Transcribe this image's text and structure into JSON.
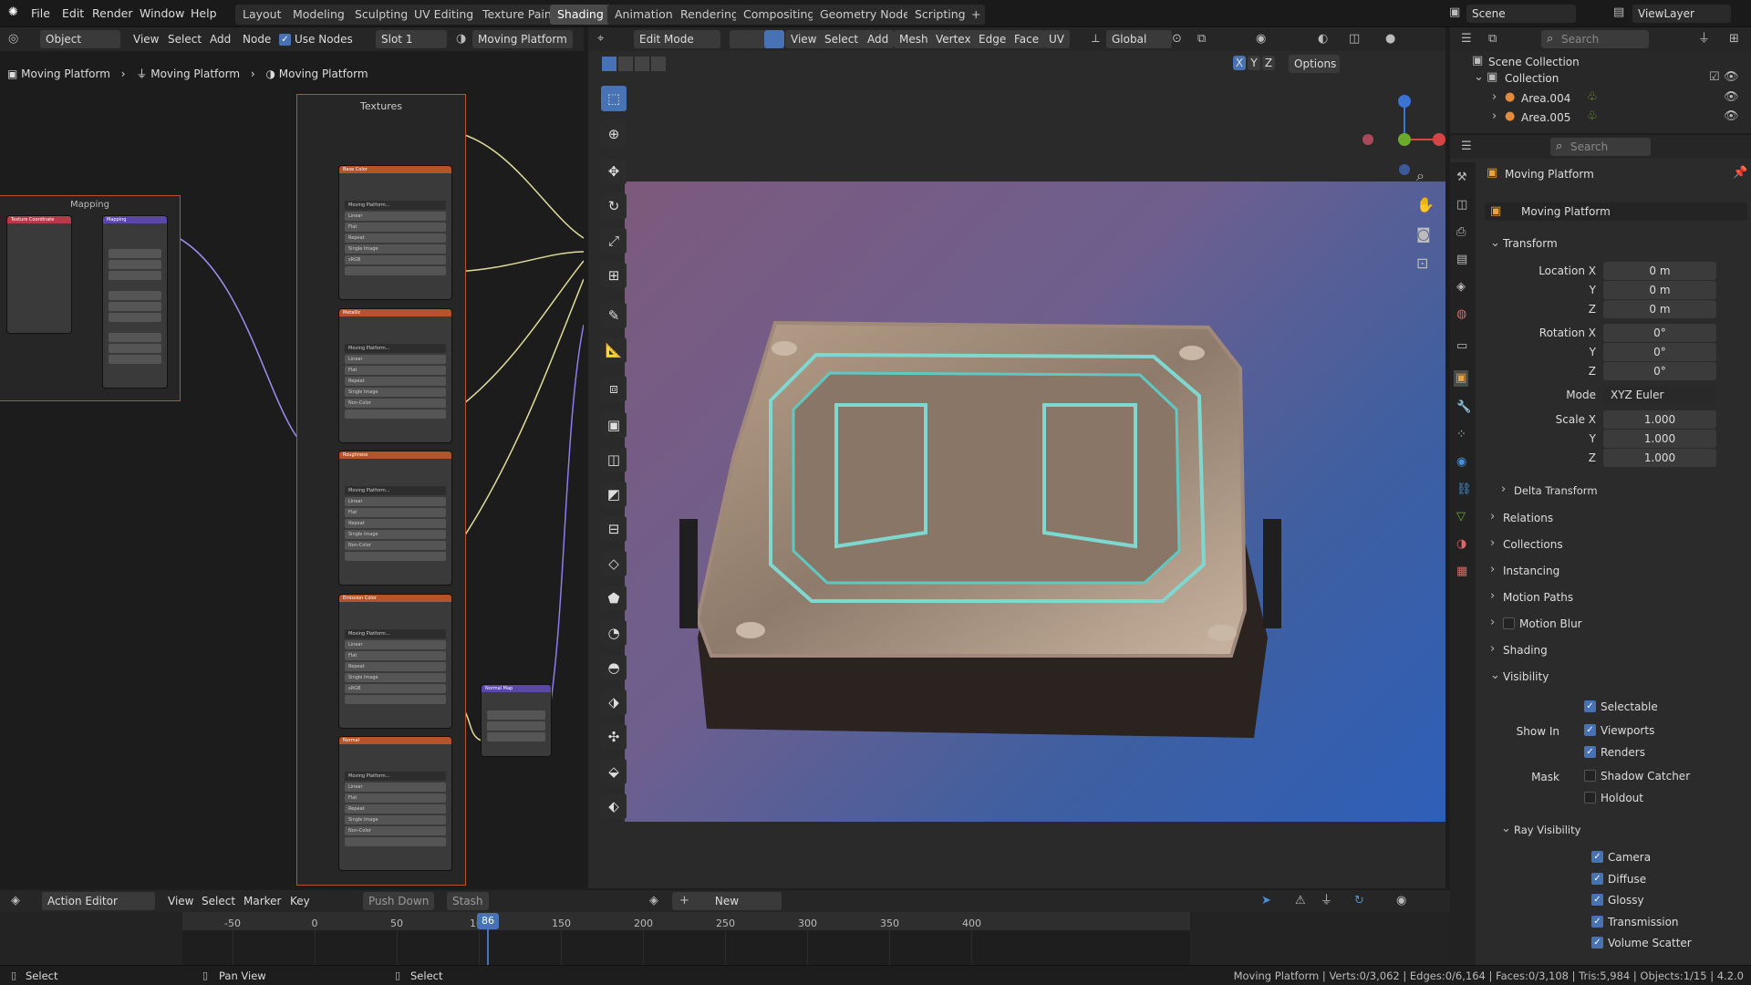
{
  "menubar": {
    "items": [
      "File",
      "Edit",
      "Render",
      "Window",
      "Help"
    ]
  },
  "workspaces": [
    "Layout",
    "Modeling",
    "Sculpting",
    "UV Editing",
    "Texture Paint",
    "Shading",
    "Animation",
    "Rendering",
    "Compositing",
    "Geometry Nodes",
    "Scripting"
  ],
  "active_workspace": "Shading",
  "scene": {
    "label": "Scene",
    "view_layer": "ViewLayer"
  },
  "node_editor": {
    "mode": "Object",
    "menus": [
      "View",
      "Select",
      "Add",
      "Node"
    ],
    "use_nodes": "Use Nodes",
    "slot": "Slot 1",
    "material": "Moving Platform",
    "breadcrumb": [
      "Moving Platform",
      "Moving Platform",
      "Moving Platform"
    ],
    "frames": {
      "textures": "Textures",
      "mapping": "Mapping"
    },
    "nodes": {
      "tex_coord": "Texture Coordinate",
      "mapping": "Mapping",
      "normal_map": "Normal Map"
    },
    "tex_nodes": [
      {
        "title": "Base Color",
        "image": "Moving Platform...",
        "colorspace": "sRGB"
      },
      {
        "title": "Metallic",
        "image": "Moving Platform...",
        "colorspace": "Non-Color"
      },
      {
        "title": "Roughness",
        "image": "Moving Platform...",
        "colorspace": "Non-Color"
      },
      {
        "title": "Emission Color",
        "image": "Moving Platform...",
        "colorspace": "sRGB"
      },
      {
        "title": "Normal",
        "image": "Moving Platform...",
        "colorspace": "Non-Color"
      }
    ],
    "tex_rows": [
      "Linear",
      "Flat",
      "Repeat",
      "Single Image"
    ]
  },
  "viewport": {
    "mode": "Edit Mode",
    "menus": [
      "View",
      "Select",
      "Add",
      "Mesh",
      "Vertex",
      "Edge",
      "Face",
      "UV"
    ],
    "orientation": "Global",
    "options": "Options",
    "axes": [
      "X",
      "Y",
      "Z"
    ]
  },
  "outliner": {
    "search_placeholder": "Search",
    "scene_collection": "Scene Collection",
    "collection": "Collection",
    "items": [
      "Area.004",
      "Area.005"
    ]
  },
  "properties": {
    "search_placeholder": "Search",
    "object_name": "Moving Platform",
    "name_field": "Moving Platform",
    "transform": "Transform",
    "location_label": "Location X",
    "loc": [
      "0 m",
      "0 m",
      "0 m"
    ],
    "rotation_label": "Rotation X",
    "rot": [
      "0°",
      "0°",
      "0°"
    ],
    "mode_label": "Mode",
    "mode_value": "XYZ Euler",
    "scale_label": "Scale X",
    "scale": [
      "1.000",
      "1.000",
      "1.000"
    ],
    "y": "Y",
    "z": "Z",
    "delta": "Delta Transform",
    "sections": [
      "Relations",
      "Collections",
      "Instancing",
      "Motion Paths",
      "Motion Blur",
      "Shading",
      "Visibility"
    ],
    "selectable": "Selectable",
    "show_in": "Show In",
    "viewports": "Viewports",
    "renders": "Renders",
    "mask": "Mask",
    "shadow_catcher": "Shadow Catcher",
    "holdout": "Holdout",
    "ray_visibility": "Ray Visibility",
    "rays": [
      "Camera",
      "Diffuse",
      "Glossy",
      "Transmission",
      "Volume Scatter"
    ]
  },
  "timeline": {
    "editor": "Action Editor",
    "menus": [
      "View",
      "Select",
      "Marker",
      "Key"
    ],
    "push_down": "Push Down",
    "stash": "Stash",
    "new": "New",
    "ticks": [
      "-50",
      "0",
      "50",
      "100",
      "150",
      "200",
      "250",
      "300",
      "350",
      "400"
    ],
    "current_frame": "86"
  },
  "statusbar": {
    "left": [
      "Select",
      "Pan View",
      "Select"
    ],
    "info": "Moving Platform | Verts:0/3,062 | Edges:0/6,164 | Faces:0/3,108 | Tris:5,984 | Objects:1/15 | 4.2.0"
  },
  "colors": {
    "accent": "#4772b3",
    "node_image": "#b5542a",
    "node_vector": "#5a47a8",
    "node_input": "#b83a4a",
    "frame_border": "#b5542a"
  }
}
